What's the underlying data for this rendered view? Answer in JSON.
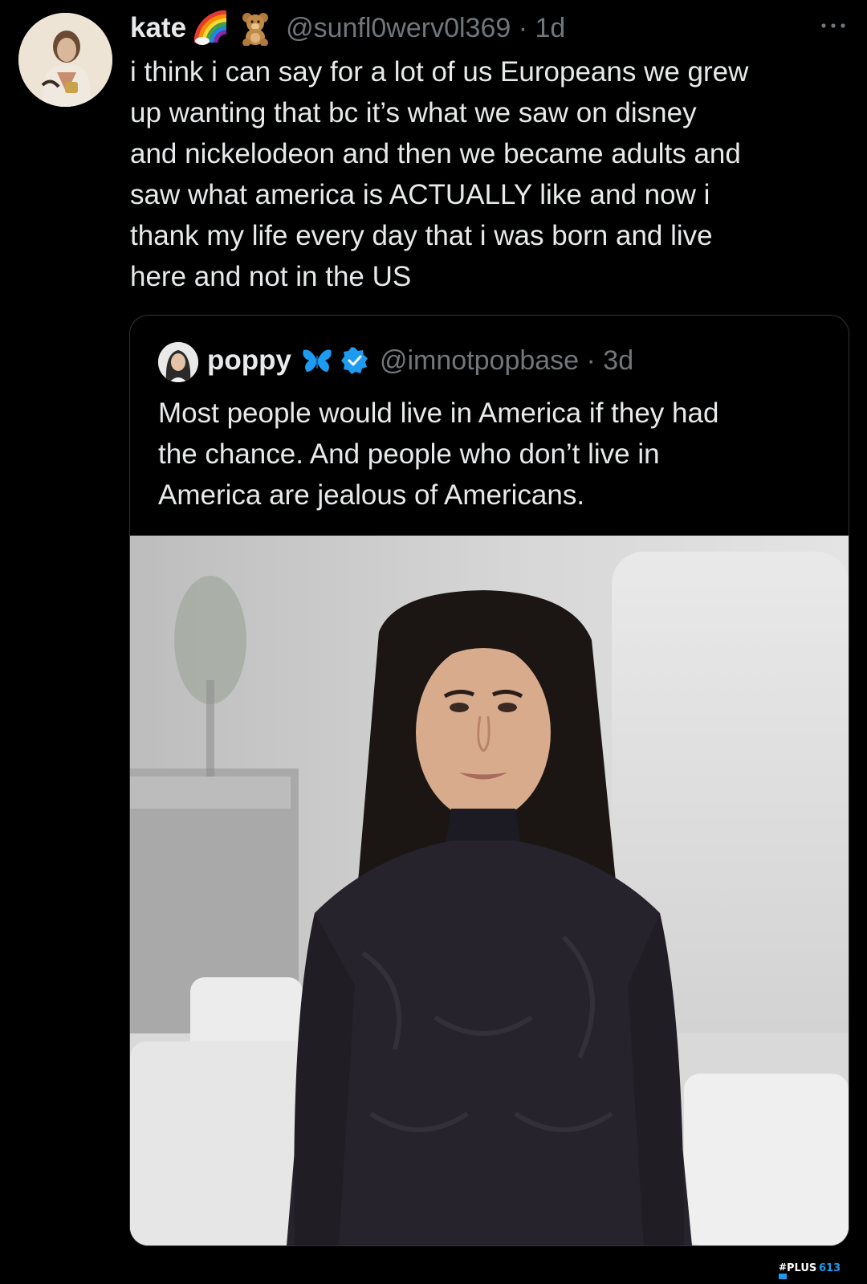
{
  "tweet": {
    "author": {
      "display_name": "kate",
      "emojis": [
        "rainbow-emoji",
        "teddy-bear-emoji"
      ],
      "handle": "@sunfl0werv0l369",
      "separator": "·",
      "time": "1d",
      "handle_time": "@sunfl0werv0l369 · 1d"
    },
    "text_lines": [
      "i think i can say for a lot of us Europeans we grew",
      "up wanting that bc it’s what we saw on disney",
      "and nickelodeon and then we became adults and",
      "saw what america is ACTUALLY like and now i",
      "thank my life every day that i was born and live",
      "here and not in the US"
    ],
    "more_icon": "more-horizontal-icon"
  },
  "quote": {
    "author": {
      "display_name": "poppy",
      "emoji": "butterfly-emoji",
      "verified_icon": "verified-badge-icon",
      "handle_time": "@imnotpopbase · 3d"
    },
    "text_lines": [
      "Most people would live in America if they had",
      "the chance. And people who don’t live in",
      "America are jealous of Americans."
    ],
    "media": {
      "kind": "photo",
      "icon": "portrait-photo"
    }
  },
  "watermark": {
    "text": "PLUS613"
  },
  "colors": {
    "background": "#000000",
    "text_primary": "#e7e9ea",
    "text_secondary": "#71767b",
    "border": "#2f3336",
    "verified_blue": "#1d9bf0",
    "butterfly_blue": "#1d9bf0"
  }
}
